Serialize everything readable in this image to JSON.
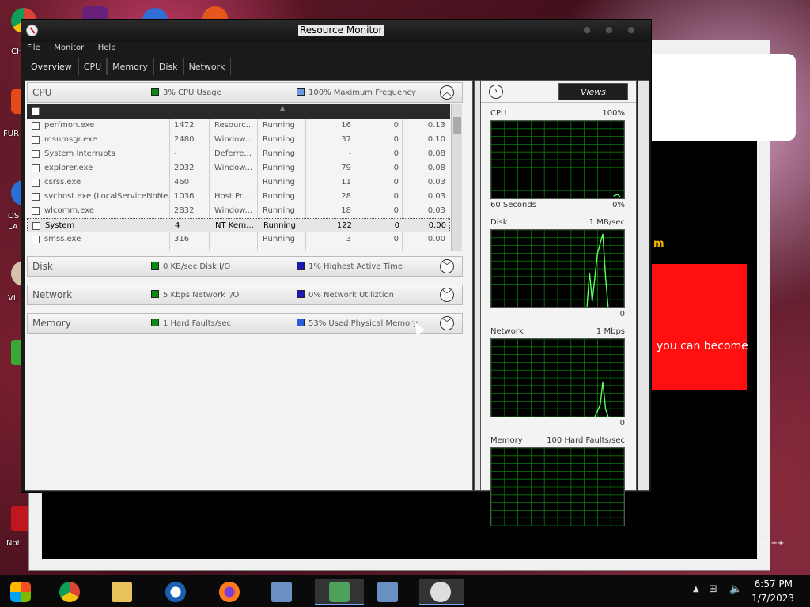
{
  "window": {
    "title": "Resource Monitor",
    "menu": [
      "File",
      "Monitor",
      "Help"
    ],
    "tabs": [
      "Overview",
      "CPU",
      "Memory",
      "Disk",
      "Network"
    ],
    "active_tab": "Overview"
  },
  "sections": {
    "cpu": {
      "title": "CPU",
      "legend1": "3% CPU Usage",
      "legend2": "100% Maximum Frequency",
      "color1": "#0b8a12",
      "color2": "#6a9bde"
    },
    "disk": {
      "title": "Disk",
      "legend1": "0 KB/sec Disk I/O",
      "legend2": "1% Highest Active Time",
      "color1": "#0b8a12",
      "color2": "#1a1ab0"
    },
    "network": {
      "title": "Network",
      "legend1": "5 Kbps Network I/O",
      "legend2": "0% Network Utiliztion",
      "color1": "#0b8a12",
      "color2": "#1a1ab0"
    },
    "memory": {
      "title": "Memory",
      "legend1": "1 Hard Faults/sec",
      "legend2": "53% Used Physical Memory",
      "color1": "#0b8a12",
      "color2": "#2a5cd6"
    }
  },
  "cpu_rows": [
    {
      "name": "perfmon.exe",
      "pid": "1472",
      "desc": "Resourc...",
      "status": "Running",
      "threads": "16",
      "cycle": "0",
      "cpu": "0.13"
    },
    {
      "name": "msnmsgr.exe",
      "pid": "2480",
      "desc": "Window...",
      "status": "Running",
      "threads": "37",
      "cycle": "0",
      "cpu": "0.10"
    },
    {
      "name": "System Interrupts",
      "pid": "-",
      "desc": "Deferre...",
      "status": "Running",
      "threads": "-",
      "cycle": "0",
      "cpu": "0.08"
    },
    {
      "name": "explorer.exe",
      "pid": "2032",
      "desc": "Window...",
      "status": "Running",
      "threads": "79",
      "cycle": "0",
      "cpu": "0.08"
    },
    {
      "name": "csrss.exe",
      "pid": "460",
      "desc": "",
      "status": "Running",
      "threads": "11",
      "cycle": "0",
      "cpu": "0.03"
    },
    {
      "name": "svchost.exe (LocalServiceNoNe...",
      "pid": "1036",
      "desc": "Host Pr...",
      "status": "Running",
      "threads": "28",
      "cycle": "0",
      "cpu": "0.03"
    },
    {
      "name": "wlcomm.exe",
      "pid": "2832",
      "desc": "Window...",
      "status": "Running",
      "threads": "18",
      "cycle": "0",
      "cpu": "0.03"
    },
    {
      "name": "System",
      "pid": "4",
      "desc": "NT Kern...",
      "status": "Running",
      "threads": "122",
      "cycle": "0",
      "cpu": "0.00"
    },
    {
      "name": "smss.exe",
      "pid": "316",
      "desc": "",
      "status": "Running",
      "threads": "3",
      "cycle": "0",
      "cpu": "0.00"
    }
  ],
  "selected_row": 7,
  "views_button": "Views",
  "graphs": [
    {
      "title": "CPU",
      "max": "100%",
      "bottom_left": "60 Seconds",
      "bottom_right": "0%"
    },
    {
      "title": "Disk",
      "max": "1 MB/sec",
      "bottom_left": "",
      "bottom_right": "0"
    },
    {
      "title": "Network",
      "max": "1 Mbps",
      "bottom_left": "",
      "bottom_right": "0"
    },
    {
      "title": "Memory",
      "max": "100 Hard Faults/sec",
      "bottom_left": "",
      "bottom_right": ""
    }
  ],
  "background_window": {
    "red_box_text": "you can become",
    "m_letter": "m",
    "corner_text": "n C++"
  },
  "desktop_labels": [
    "CH",
    "FUR",
    "OS",
    "LA",
    "VL",
    "Not"
  ],
  "taskbar": {
    "items": [
      "start-button",
      "chrome-icon",
      "file-explorer-icon",
      "obama-app-icon",
      "firefox-icon",
      "network-app-icon",
      "users-app-icon",
      "network-app-icon-2",
      "resource-monitor-icon"
    ],
    "time": "6:57 PM",
    "date": "1/7/2023"
  }
}
